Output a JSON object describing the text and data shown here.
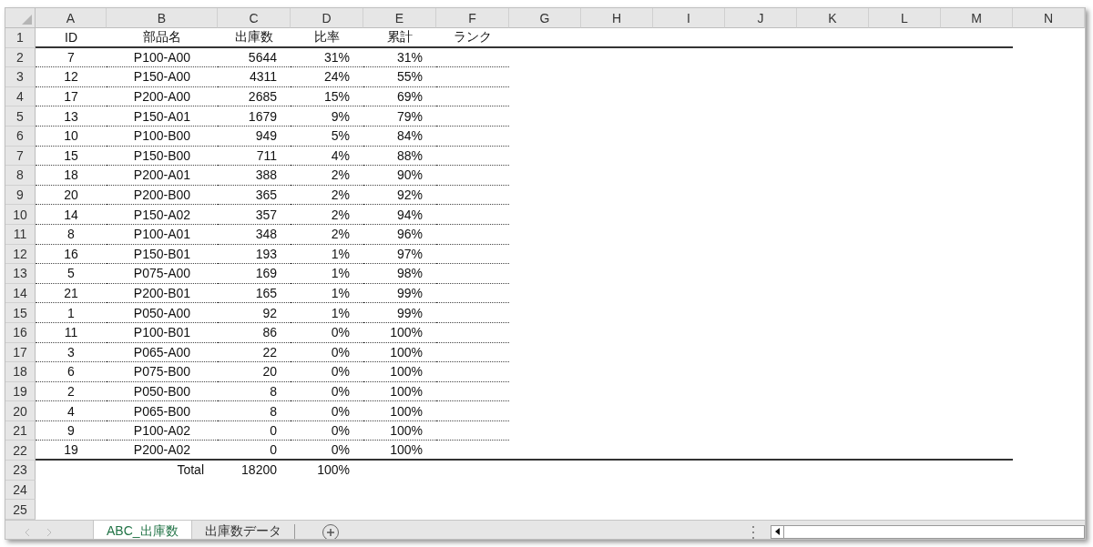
{
  "columns": [
    "A",
    "B",
    "C",
    "D",
    "E",
    "F",
    "G",
    "H",
    "I",
    "J",
    "K",
    "L",
    "M",
    "N"
  ],
  "rows": [
    {
      "number": "1",
      "kind": "header",
      "cells": [
        "ID",
        "部品名",
        "出庫数",
        "比率",
        "累計",
        "ランク"
      ]
    },
    {
      "number": "2",
      "kind": "data",
      "cells": [
        "7",
        "P100-A00",
        "5644",
        "31%",
        "31%"
      ]
    },
    {
      "number": "3",
      "kind": "data",
      "cells": [
        "12",
        "P150-A00",
        "4311",
        "24%",
        "55%"
      ]
    },
    {
      "number": "4",
      "kind": "data",
      "cells": [
        "17",
        "P200-A00",
        "2685",
        "15%",
        "69%"
      ]
    },
    {
      "number": "5",
      "kind": "data",
      "cells": [
        "13",
        "P150-A01",
        "1679",
        "9%",
        "79%"
      ]
    },
    {
      "number": "6",
      "kind": "data",
      "cells": [
        "10",
        "P100-B00",
        "949",
        "5%",
        "84%"
      ]
    },
    {
      "number": "7",
      "kind": "data",
      "cells": [
        "15",
        "P150-B00",
        "711",
        "4%",
        "88%"
      ]
    },
    {
      "number": "8",
      "kind": "data",
      "cells": [
        "18",
        "P200-A01",
        "388",
        "2%",
        "90%"
      ]
    },
    {
      "number": "9",
      "kind": "data",
      "cells": [
        "20",
        "P200-B00",
        "365",
        "2%",
        "92%"
      ]
    },
    {
      "number": "10",
      "kind": "data",
      "cells": [
        "14",
        "P150-A02",
        "357",
        "2%",
        "94%"
      ]
    },
    {
      "number": "11",
      "kind": "data",
      "cells": [
        "8",
        "P100-A01",
        "348",
        "2%",
        "96%"
      ]
    },
    {
      "number": "12",
      "kind": "data",
      "cells": [
        "16",
        "P150-B01",
        "193",
        "1%",
        "97%"
      ]
    },
    {
      "number": "13",
      "kind": "data",
      "cells": [
        "5",
        "P075-A00",
        "169",
        "1%",
        "98%"
      ]
    },
    {
      "number": "14",
      "kind": "data",
      "cells": [
        "21",
        "P200-B01",
        "165",
        "1%",
        "99%"
      ]
    },
    {
      "number": "15",
      "kind": "data",
      "cells": [
        "1",
        "P050-A00",
        "92",
        "1%",
        "99%"
      ]
    },
    {
      "number": "16",
      "kind": "data",
      "cells": [
        "11",
        "P100-B01",
        "86",
        "0%",
        "100%"
      ]
    },
    {
      "number": "17",
      "kind": "data",
      "cells": [
        "3",
        "P065-A00",
        "22",
        "0%",
        "100%"
      ]
    },
    {
      "number": "18",
      "kind": "data",
      "cells": [
        "6",
        "P075-B00",
        "20",
        "0%",
        "100%"
      ]
    },
    {
      "number": "19",
      "kind": "data",
      "cells": [
        "2",
        "P050-B00",
        "8",
        "0%",
        "100%"
      ]
    },
    {
      "number": "20",
      "kind": "data",
      "cells": [
        "4",
        "P065-B00",
        "8",
        "0%",
        "100%"
      ]
    },
    {
      "number": "21",
      "kind": "data",
      "cells": [
        "9",
        "P100-A02",
        "0",
        "0%",
        "100%"
      ]
    },
    {
      "number": "22",
      "kind": "last",
      "cells": [
        "19",
        "P200-A02",
        "0",
        "0%",
        "100%"
      ]
    },
    {
      "number": "23",
      "kind": "total",
      "cells": [
        "",
        "Total",
        "18200",
        "100%"
      ]
    },
    {
      "number": "24",
      "kind": "empty",
      "cells": []
    },
    {
      "number": "25",
      "kind": "empty",
      "cells": []
    }
  ],
  "sheet_tabs": [
    {
      "label": "ABC_出庫数",
      "selected": true
    },
    {
      "label": "出庫数データ",
      "selected": false
    }
  ]
}
